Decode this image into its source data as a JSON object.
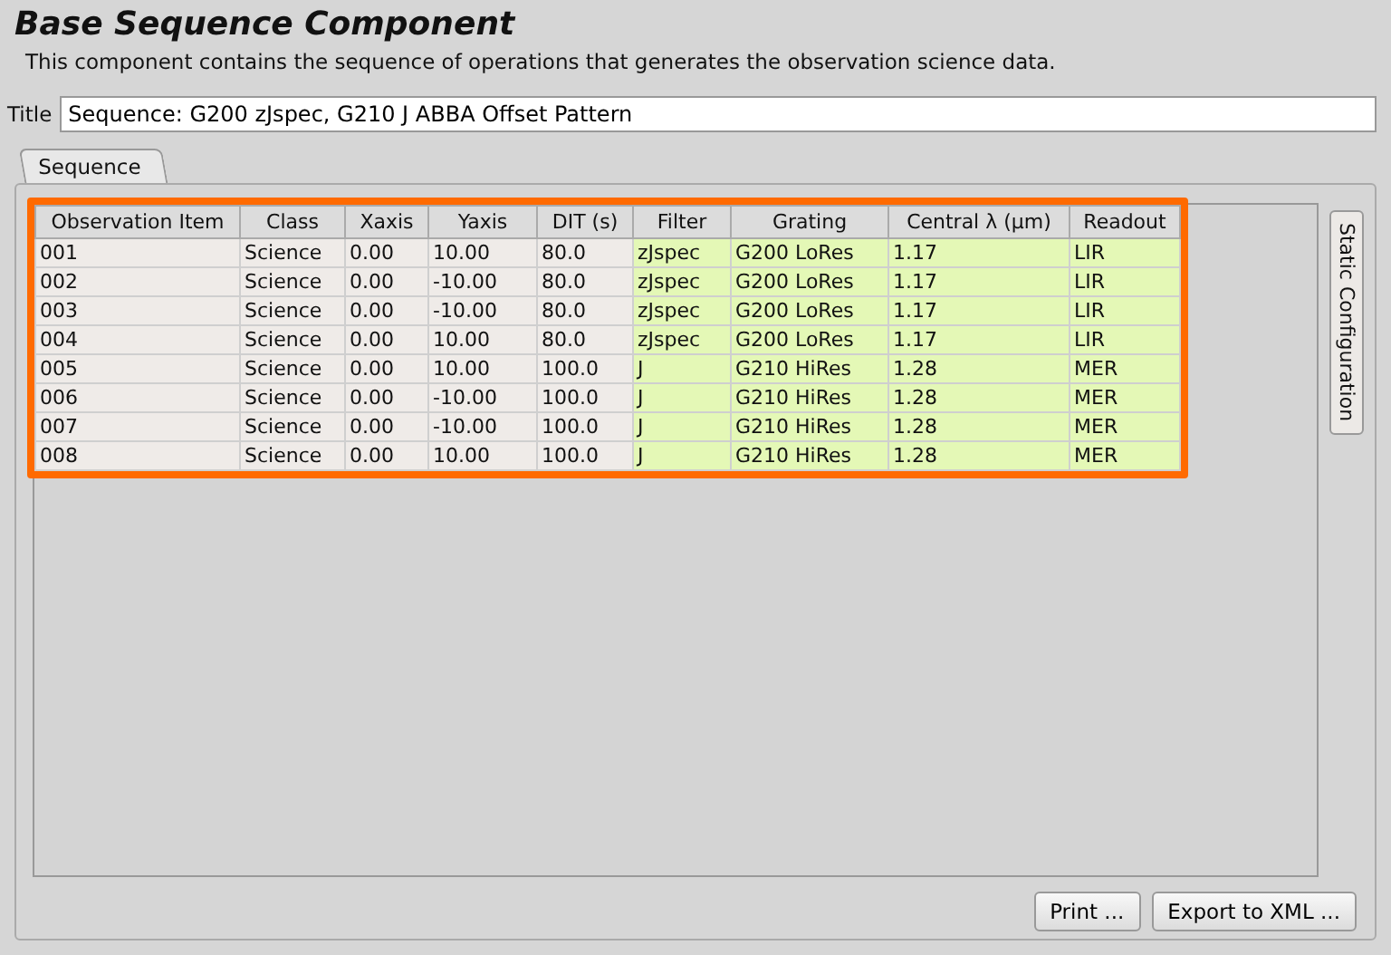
{
  "header": {
    "title": "Base Sequence Component",
    "description": "This component contains the sequence of operations that generates the observation science data."
  },
  "title_field": {
    "label": "Title",
    "value": "Sequence: G200 zJspec, G210 J ABBA Offset Pattern"
  },
  "tabs": [
    {
      "label": "Sequence",
      "selected": true
    }
  ],
  "side_tabs": [
    {
      "label": "Static Configuration",
      "selected": false
    }
  ],
  "table": {
    "highlighted": true,
    "columns": [
      {
        "label": "Observation Item",
        "editable": false
      },
      {
        "label": "Class",
        "editable": false
      },
      {
        "label": "Xaxis",
        "editable": false
      },
      {
        "label": "Yaxis",
        "editable": false
      },
      {
        "label": "DIT (s)",
        "editable": false
      },
      {
        "label": "Filter",
        "editable": true
      },
      {
        "label": "Grating",
        "editable": true
      },
      {
        "label": "Central λ (µm)",
        "editable": true
      },
      {
        "label": "Readout",
        "editable": true
      }
    ],
    "rows": [
      [
        "001",
        "Science",
        "0.00",
        "10.00",
        "80.0",
        "zJspec",
        "G200 LoRes",
        "1.17",
        "LIR"
      ],
      [
        "002",
        "Science",
        "0.00",
        "-10.00",
        "80.0",
        "zJspec",
        "G200 LoRes",
        "1.17",
        "LIR"
      ],
      [
        "003",
        "Science",
        "0.00",
        "-10.00",
        "80.0",
        "zJspec",
        "G200 LoRes",
        "1.17",
        "LIR"
      ],
      [
        "004",
        "Science",
        "0.00",
        "10.00",
        "80.0",
        "zJspec",
        "G200 LoRes",
        "1.17",
        "LIR"
      ],
      [
        "005",
        "Science",
        "0.00",
        "10.00",
        "100.0",
        "J",
        "G210 HiRes",
        "1.28",
        "MER"
      ],
      [
        "006",
        "Science",
        "0.00",
        "-10.00",
        "100.0",
        "J",
        "G210 HiRes",
        "1.28",
        "MER"
      ],
      [
        "007",
        "Science",
        "0.00",
        "-10.00",
        "100.0",
        "J",
        "G210 HiRes",
        "1.28",
        "MER"
      ],
      [
        "008",
        "Science",
        "0.00",
        "10.00",
        "100.0",
        "J",
        "G210 HiRes",
        "1.28",
        "MER"
      ]
    ]
  },
  "buttons": [
    "Print ...",
    "Export to XML ..."
  ]
}
